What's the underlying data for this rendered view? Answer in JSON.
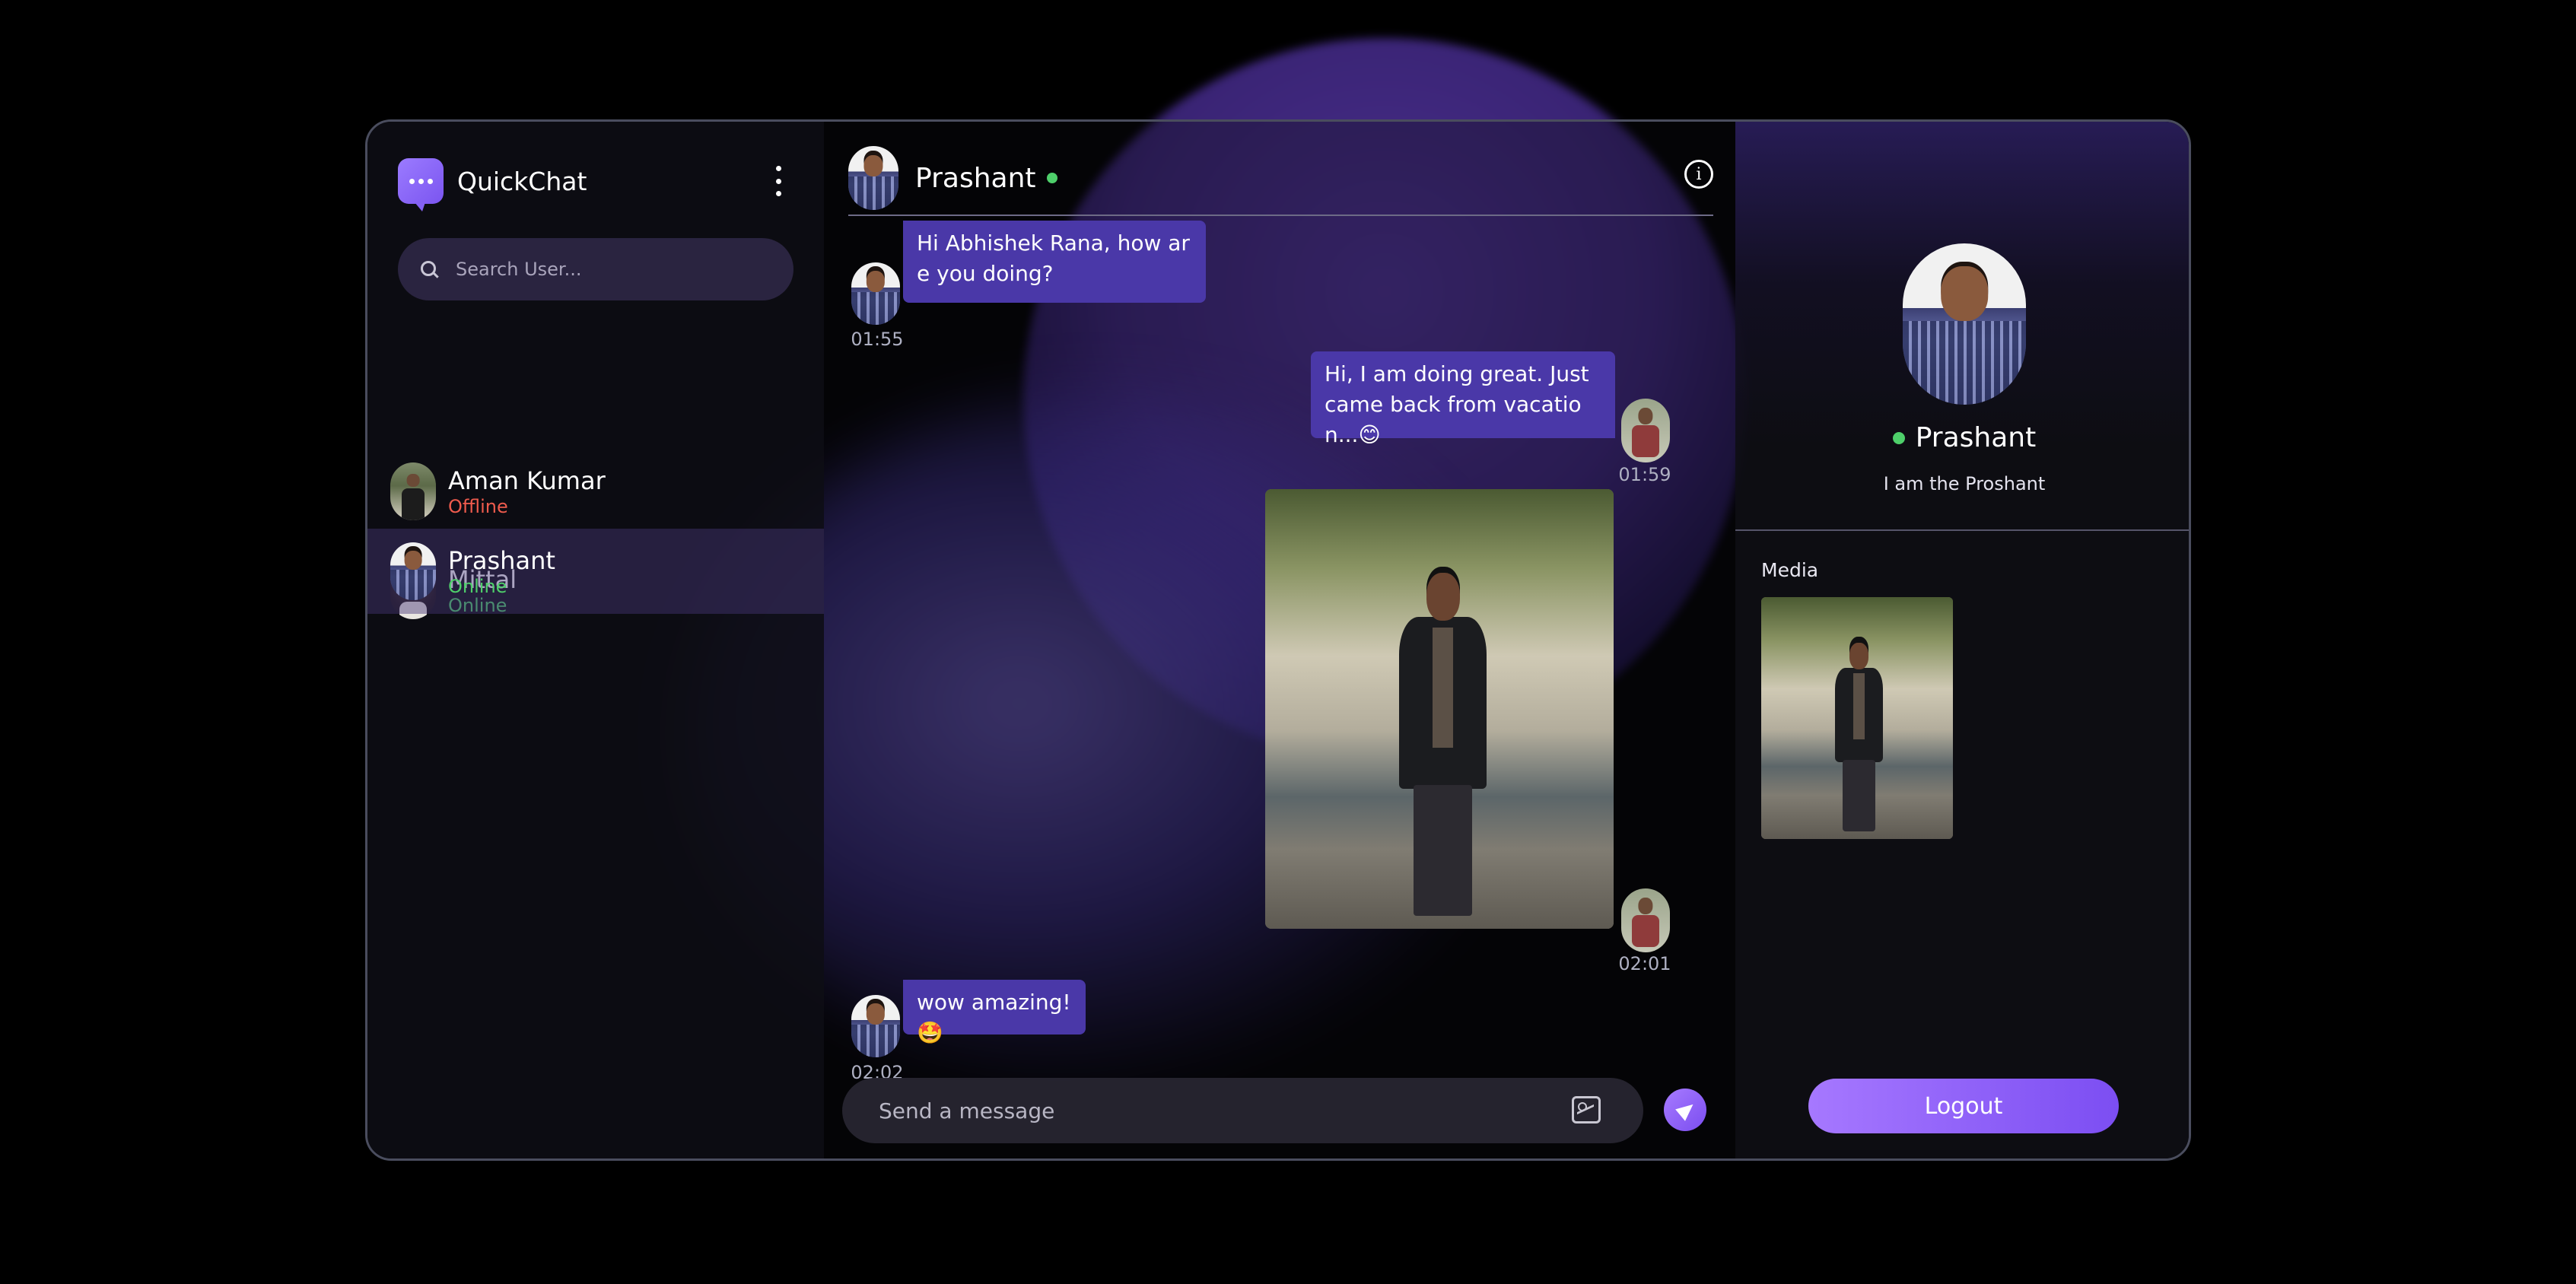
{
  "app": {
    "name": "QuickChat"
  },
  "search": {
    "placeholder": "Search User..."
  },
  "users": [
    {
      "name": "Aman Kumar",
      "status": "Offline"
    },
    {
      "name": "Mittal",
      "status": "Online"
    },
    {
      "name": "Prashant",
      "status": "Online"
    }
  ],
  "chat": {
    "contact_name": "Prashant",
    "messages": [
      {
        "text": "Hi Abhishek Rana, how are you doing?",
        "time": "01:55",
        "direction": "incoming"
      },
      {
        "text": "Hi, I am doing great. Just came back from vacation...😊",
        "time": "01:59",
        "direction": "outgoing"
      },
      {
        "type": "image",
        "time": "02:01",
        "direction": "outgoing"
      },
      {
        "text": "wow amazing!🤩",
        "time": "02:02",
        "direction": "incoming"
      }
    ],
    "composer_placeholder": "Send a message"
  },
  "profile": {
    "name": "Prashant",
    "bio": "I am the Proshant",
    "media_label": "Media",
    "logout_label": "Logout"
  },
  "colors": {
    "accent": "#8a5cf6",
    "bubble": "#4a38a8",
    "online": "#4ecf6a",
    "offline": "#ef5b4d"
  },
  "icons": [
    "chat-logo-icon",
    "more-vertical-icon",
    "search-icon",
    "info-icon",
    "gallery-icon",
    "send-icon"
  ]
}
